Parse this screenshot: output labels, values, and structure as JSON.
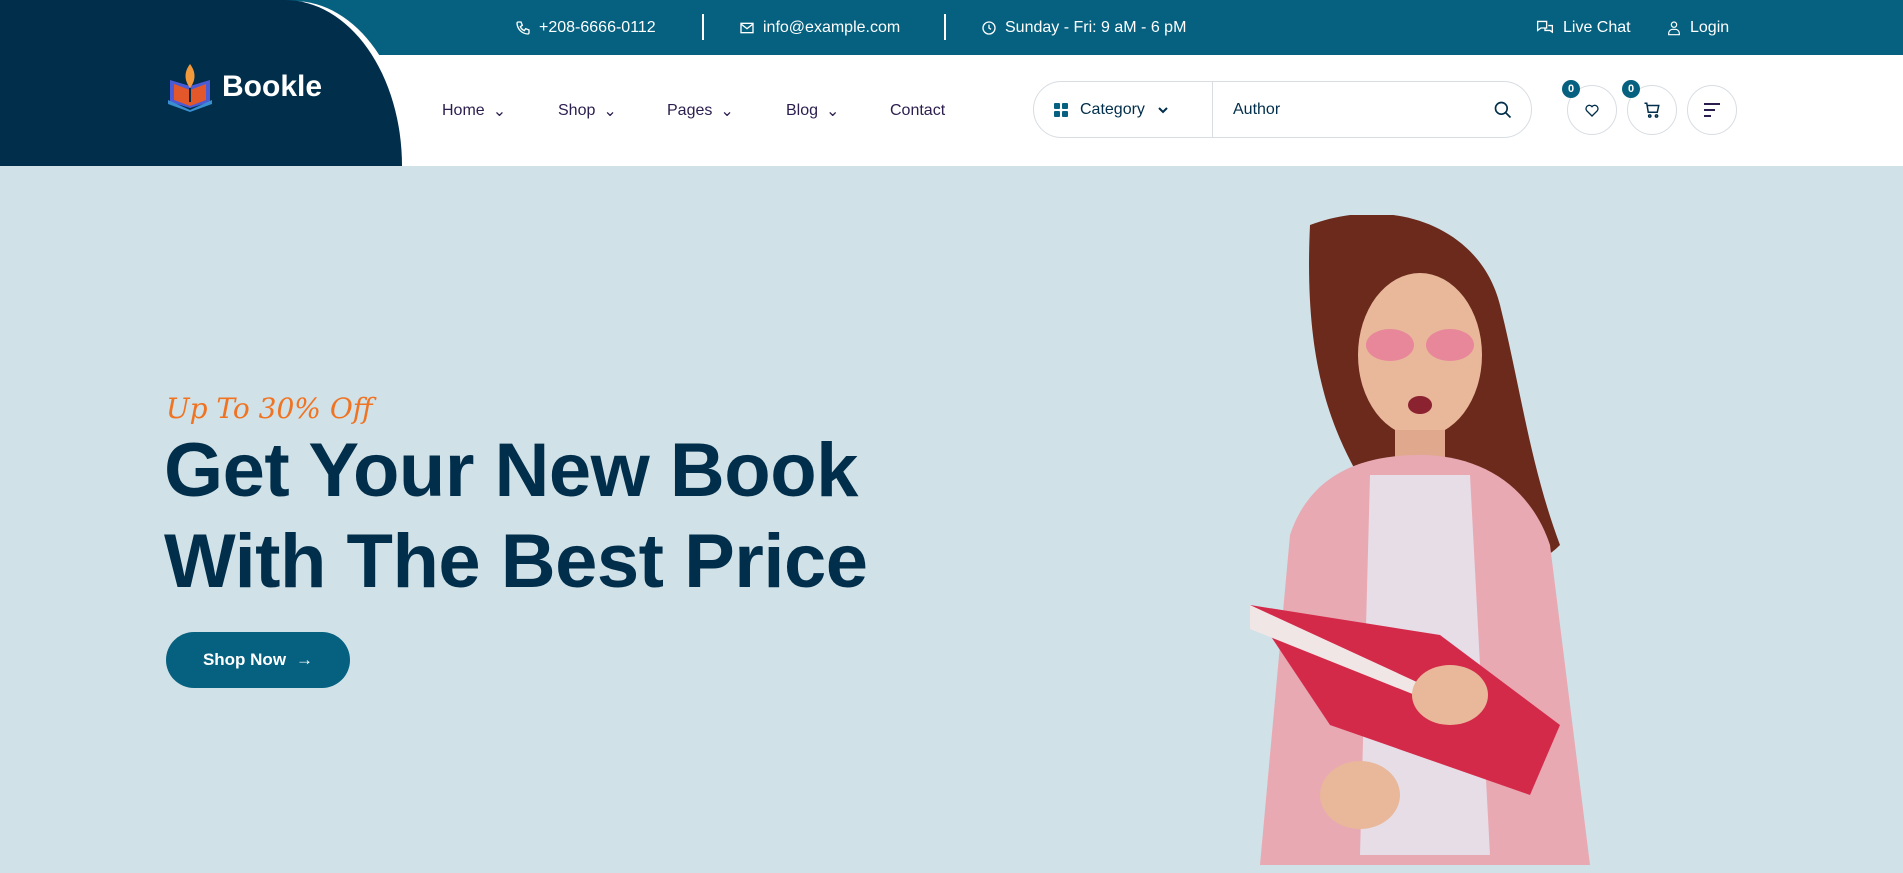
{
  "topbar": {
    "phone": "+208-6666-0112",
    "email": "info@example.com",
    "hours": "Sunday - Fri: 9 aM - 6 pM",
    "live_chat": "Live Chat",
    "login": "Login"
  },
  "brand": {
    "name": "Bookle"
  },
  "nav": [
    {
      "label": "Home",
      "dropdown": true
    },
    {
      "label": "Shop",
      "dropdown": true
    },
    {
      "label": "Pages",
      "dropdown": true
    },
    {
      "label": "Blog",
      "dropdown": true
    },
    {
      "label": "Contact",
      "dropdown": false
    }
  ],
  "search": {
    "category": "Category",
    "value": "Author"
  },
  "actions": {
    "wishlist_count": "0",
    "cart_count": "0"
  },
  "hero": {
    "tagline": "Up To 30% Off",
    "title_line1": "Get Your New Book",
    "title_line2": "With The Best Price",
    "button": "Shop Now"
  },
  "colors": {
    "primary": "#05617f",
    "dark": "#012e4a",
    "accent": "#f07322",
    "hero_bg": "#d0e1e7"
  }
}
